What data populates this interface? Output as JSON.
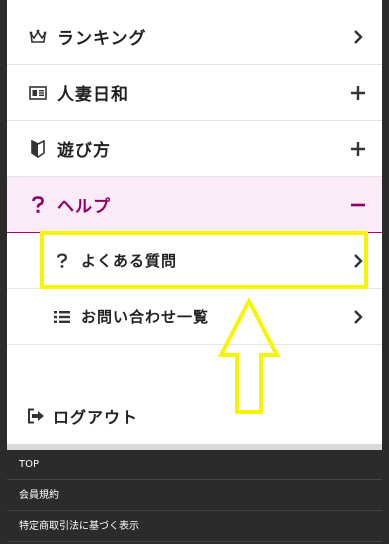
{
  "menu": {
    "ranking": "ランキング",
    "hitozuma": "人妻日和",
    "asobikata": "遊び方",
    "help": "ヘルプ",
    "faq": "よくある質問",
    "contact_list": "お問い合わせ一覧",
    "logout": "ログアウト"
  },
  "footer": {
    "links": [
      "TOP",
      "会員規約",
      "特定商取引法に基づく表示"
    ]
  },
  "colors": {
    "accent": "#8a0066",
    "highlight": "#f6f600"
  }
}
